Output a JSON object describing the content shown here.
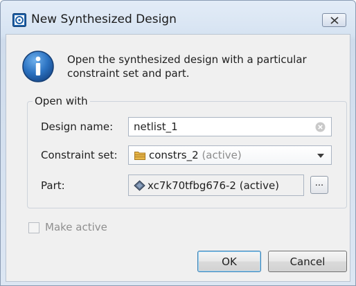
{
  "window": {
    "title": "New Synthesized Design"
  },
  "info": {
    "text": "Open the synthesized design with a particular constraint set and part."
  },
  "group": {
    "title": "Open with"
  },
  "fields": {
    "design_name": {
      "label": "Design name:",
      "value": "netlist_1"
    },
    "constraint_set": {
      "label": "Constraint set:",
      "value": "constrs_2",
      "suffix": "(active)"
    },
    "part": {
      "label": "Part:",
      "value": "xc7k70tfbg676-2 (active)",
      "browse_label": "..."
    }
  },
  "make_active": {
    "label": "Make active",
    "checked": false,
    "enabled": false
  },
  "buttons": {
    "ok": "OK",
    "cancel": "Cancel"
  },
  "colors": {
    "accent": "#1f6fb5",
    "folder": "#e8b84a",
    "disabled_text": "#8f8f8f"
  },
  "icons": {
    "title": "app-icon",
    "info": "info-icon",
    "close": "close-icon",
    "clear": "clear-icon",
    "folder": "folder-icon",
    "part": "chip-icon",
    "dropdown": "chevron-down-icon"
  }
}
